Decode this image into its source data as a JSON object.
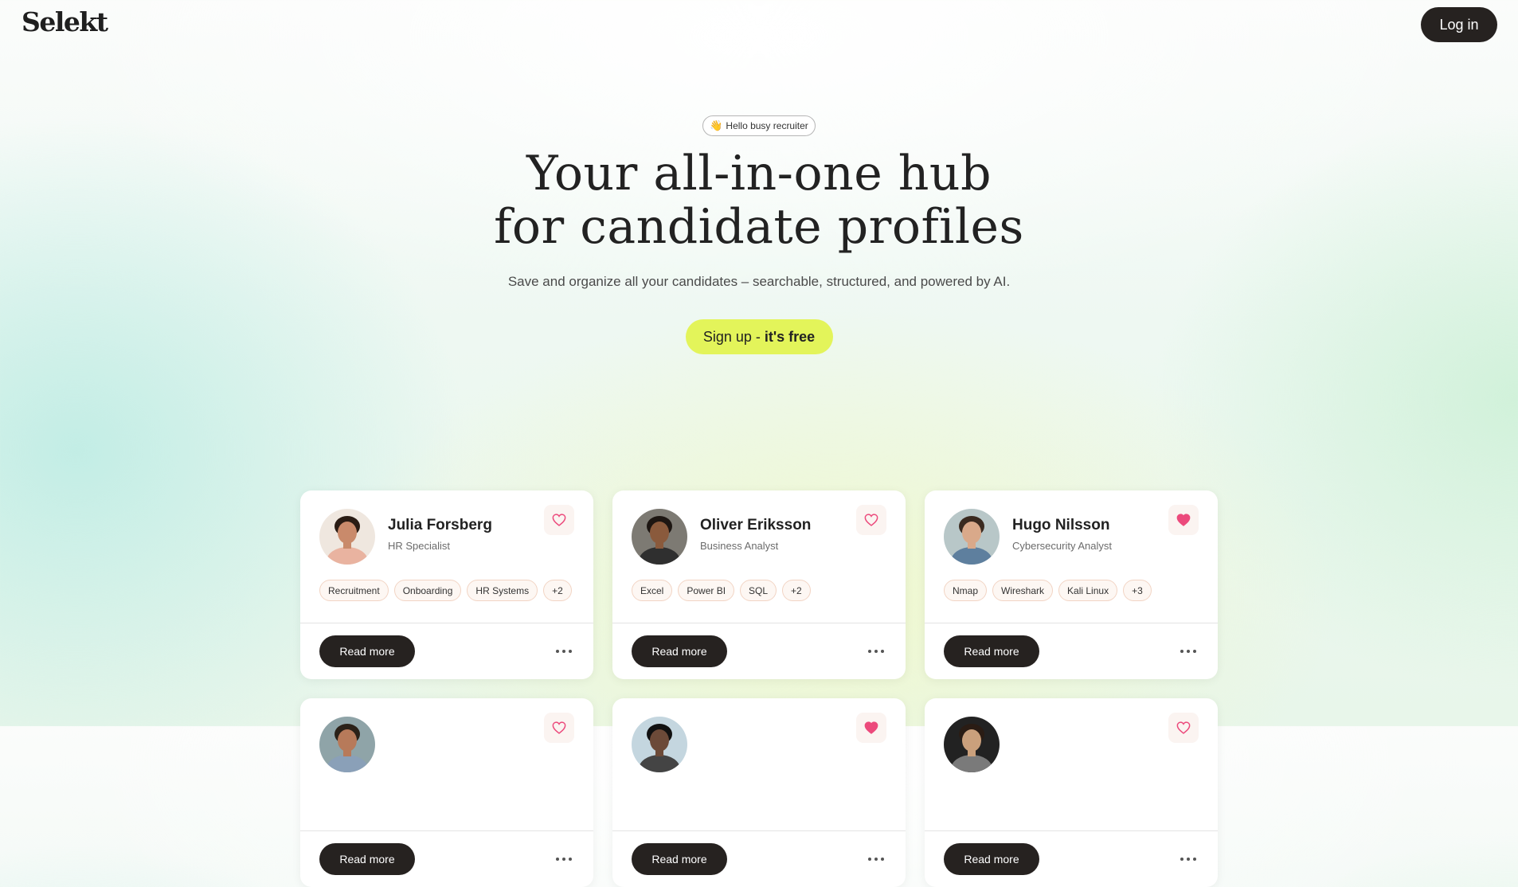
{
  "brand": "Selekt",
  "header": {
    "login_label": "Log in"
  },
  "hero": {
    "badge_emoji": "👋",
    "badge_text": "Hello busy recruiter",
    "title_line1": "Your all-in-one hub",
    "title_line2": "for candidate profiles",
    "subtitle": "Save and organize all your candidates – searchable, structured, and powered by AI.",
    "cta_prefix": "Sign up - ",
    "cta_bold": "it's free"
  },
  "colors": {
    "accent": "#e3f45a",
    "dark": "#262220",
    "heart": "#ec4a7c"
  },
  "card_labels": {
    "read_more": "Read more"
  },
  "candidates": [
    {
      "name": "Julia Forsberg",
      "role": "HR Specialist",
      "favorite": false,
      "tags": [
        "Recruitment",
        "Onboarding",
        "HR Systems",
        "+2"
      ]
    },
    {
      "name": "Oliver Eriksson",
      "role": "Business Analyst",
      "favorite": false,
      "tags": [
        "Excel",
        "Power BI",
        "SQL",
        "+2"
      ]
    },
    {
      "name": "Hugo Nilsson",
      "role": "Cybersecurity Analyst",
      "favorite": true,
      "tags": [
        "Nmap",
        "Wireshark",
        "Kali Linux",
        "+3"
      ]
    },
    {
      "name": "",
      "role": "",
      "favorite": false,
      "tags": []
    },
    {
      "name": "",
      "role": "",
      "favorite": true,
      "tags": []
    },
    {
      "name": "",
      "role": "",
      "favorite": false,
      "tags": []
    }
  ]
}
